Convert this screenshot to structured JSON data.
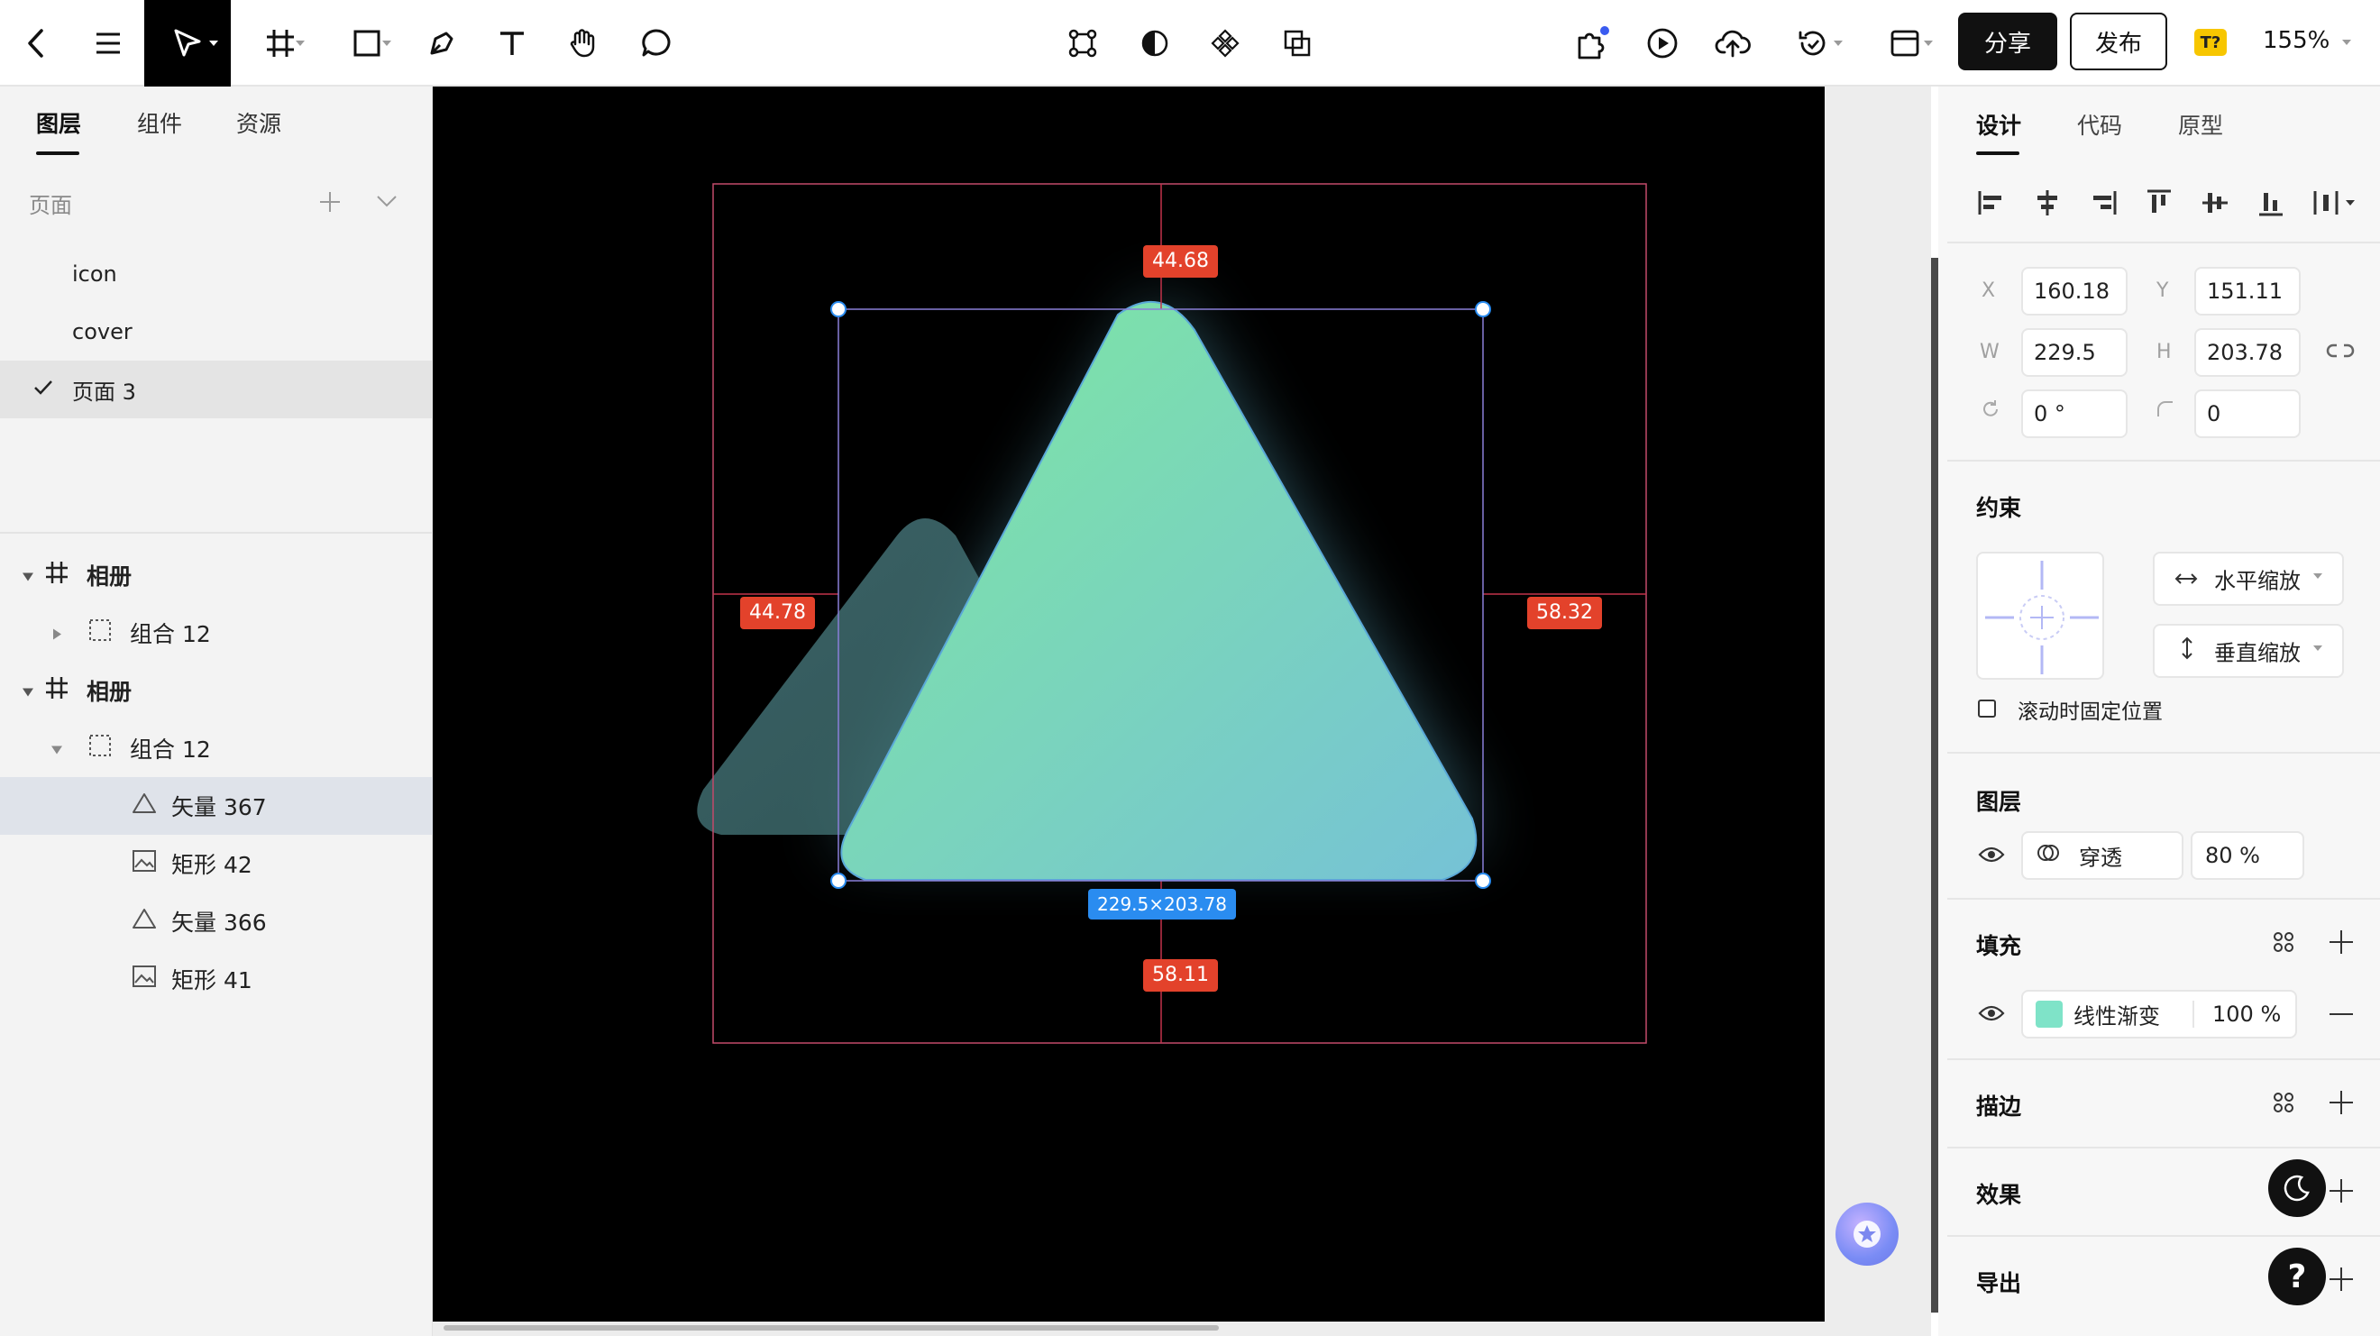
{
  "toolbar": {
    "share_label": "分享",
    "publish_label": "发布",
    "badge_label": "T?",
    "zoom": "155%",
    "icons": [
      "back-arrow-icon",
      "menu-icon",
      "move-tool-icon",
      "frame-tool-icon",
      "rectangle-tool-icon",
      "pen-tool-icon",
      "text-tool-icon",
      "hand-tool-icon",
      "comment-tool-icon",
      "boolean-icon",
      "mask-icon",
      "component-icon",
      "copy-style-icon",
      "plugin-icon",
      "play-icon",
      "upload-icon",
      "history-icon",
      "layout-icon"
    ]
  },
  "left_panel": {
    "tabs": [
      "图层",
      "组件",
      "资源"
    ],
    "pages_header": "页面",
    "pages": [
      "icon",
      "cover",
      "页面 3"
    ],
    "layers": [
      {
        "label": "相册",
        "type": "frame"
      },
      {
        "label": "组合 12",
        "type": "group"
      },
      {
        "label": "相册",
        "type": "frame"
      },
      {
        "label": "组合 12",
        "type": "group"
      },
      {
        "label": "矢量 367",
        "type": "vector"
      },
      {
        "label": "矩形 42",
        "type": "image"
      },
      {
        "label": "矢量 366",
        "type": "vector"
      },
      {
        "label": "矩形 41",
        "type": "image"
      }
    ]
  },
  "canvas": {
    "measure_top": "44.68",
    "measure_left": "44.78",
    "measure_right": "58.32",
    "measure_bottom": "58.11",
    "size_label": "229.5×203.78",
    "colors": {
      "tri_start": "#7ae0a6",
      "tri_end": "#78c8d4",
      "measure": "#e3422b",
      "selection": "#2a8cf0"
    }
  },
  "right_panel": {
    "tabs": [
      "设计",
      "代码",
      "原型"
    ],
    "x_label": "X",
    "x_value": "160.18",
    "y_label": "Y",
    "y_value": "151.11",
    "w_label": "W",
    "w_value": "229.5",
    "h_label": "H",
    "h_value": "203.78",
    "rotation_value": "0 °",
    "radius_value": "0",
    "constraints_title": "约束",
    "constraint_h": "水平缩放",
    "constraint_v": "垂直缩放",
    "fixed_scroll_label": "滚动时固定位置",
    "layer_title": "图层",
    "blend_mode": "穿透",
    "opacity": "80 %",
    "fill_title": "填充",
    "fill_type": "线性渐变",
    "fill_opacity": "100 %",
    "fill_swatch_color": "#7fe3c8",
    "stroke_title": "描边",
    "effects_title": "效果",
    "export_title": "导出",
    "help_label": "?"
  }
}
